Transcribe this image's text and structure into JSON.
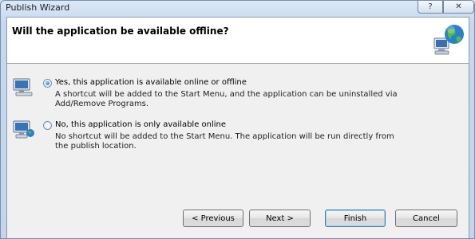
{
  "window": {
    "title": "Publish Wizard",
    "help_label": "?",
    "close_label": "✕"
  },
  "header": {
    "title": "Will the application be available offline?"
  },
  "options": [
    {
      "label": "Yes, this application is available online or offline",
      "description": "A shortcut will be added to the Start Menu, and the application can be uninstalled via Add/Remove Programs.",
      "selected": true
    },
    {
      "label": "No, this application is only available online",
      "description": "No shortcut will be added to the Start Menu. The application will be run directly from the publish location.",
      "selected": false
    }
  ],
  "buttons": {
    "previous": "< Previous",
    "next": "Next >",
    "finish": "Finish",
    "cancel": "Cancel"
  },
  "colors": {
    "accent": "#3c7fb1",
    "header_bg": "#ffffff",
    "client_bg": "#f0f0f0"
  }
}
